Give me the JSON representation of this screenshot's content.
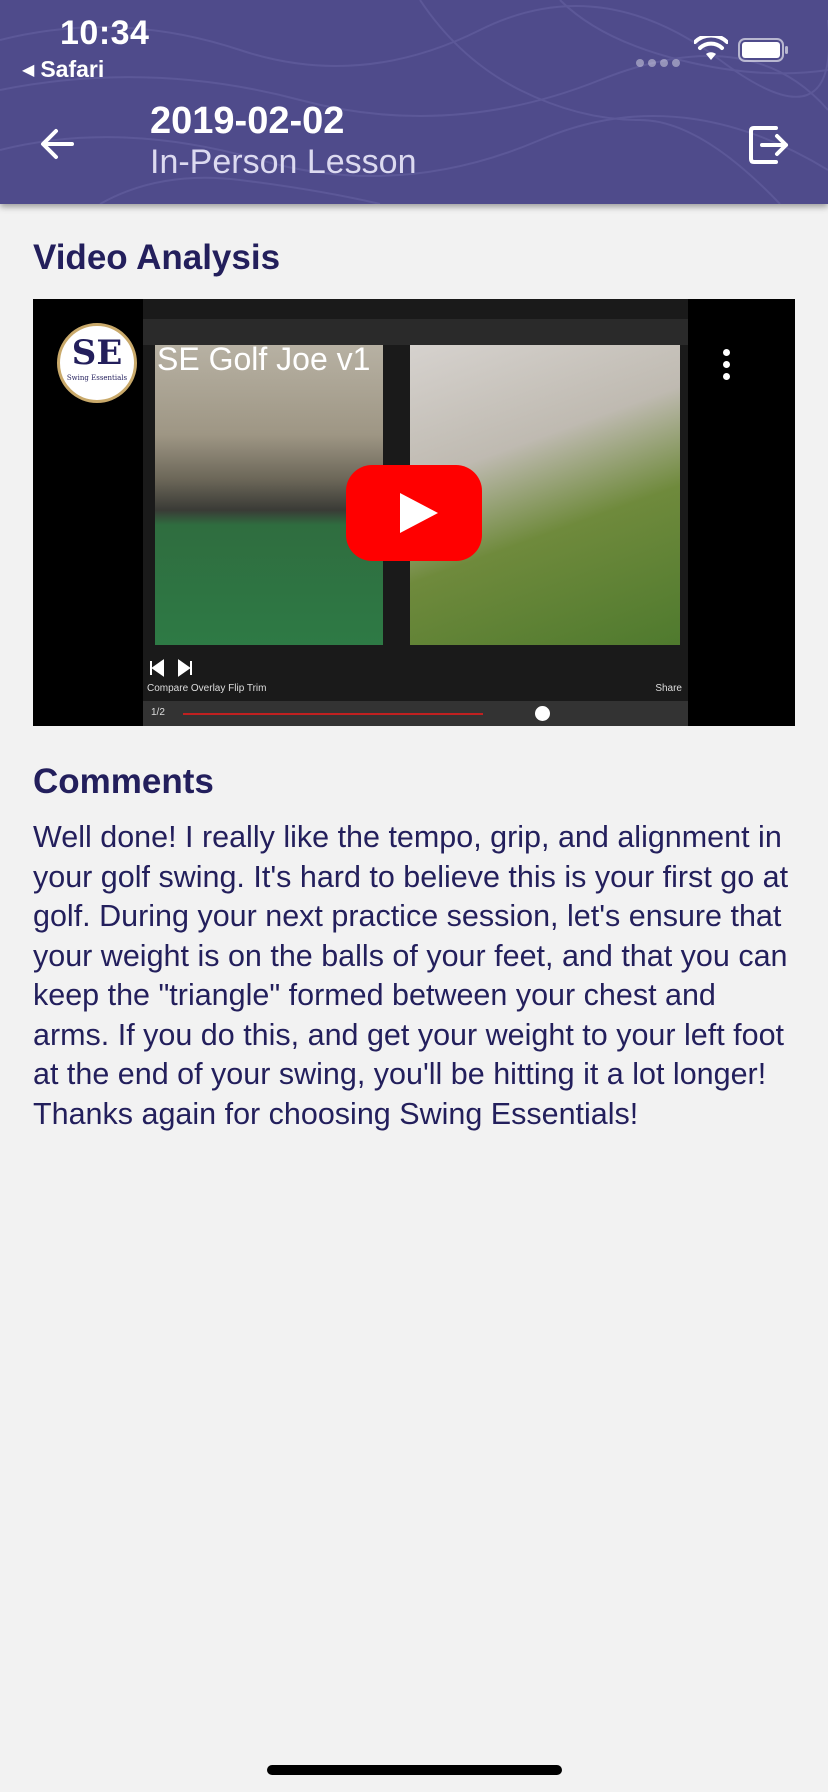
{
  "status_bar": {
    "time": "10:34",
    "back_app": "Safari",
    "icons": [
      "signal-icon",
      "wifi-icon",
      "battery-icon"
    ]
  },
  "header": {
    "date": "2019-02-02",
    "subtitle": "In-Person Lesson",
    "back_icon": "arrow-left-icon",
    "action_icon": "logout-icon",
    "background_color": "#4f4b8b"
  },
  "video_section": {
    "title": "Video Analysis",
    "video": {
      "title": "SE Golf Joe v1",
      "channel_logo": "SE",
      "channel_logo_subtitle": "Swing Essentials",
      "controls_left": "1/2",
      "controls_text": "Compare Overlay Flip Trim",
      "share_text": "Share",
      "play_icon": "youtube-play-icon",
      "menu_icon": "more-vertical-icon"
    }
  },
  "comments_section": {
    "title": "Comments",
    "text": "Well done! I really like the tempo, grip, and alignment in your golf swing. It's hard to believe this is your first go at golf. During your next practice session, let's ensure that your weight is on the balls of your feet, and that you can keep the \"triangle\" formed between your chest and arms. If you do this, and get your weight to your left foot at the end of your swing, you'll be hitting it a lot longer! Thanks again for choosing Swing Essentials!"
  },
  "colors": {
    "accent": "#231f5c",
    "header": "#4f4b8b",
    "background": "#f2f2f2",
    "youtube_red": "#ff0000"
  }
}
